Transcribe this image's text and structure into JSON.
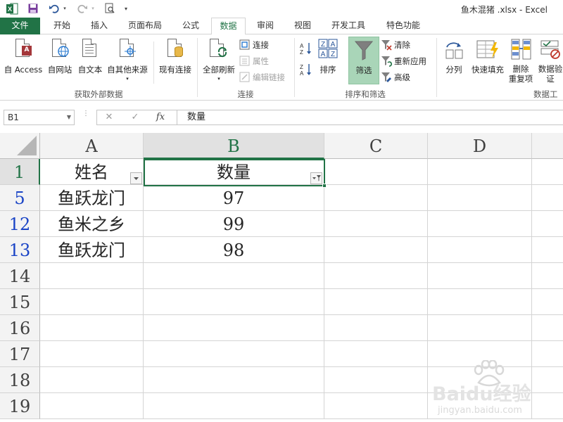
{
  "window": {
    "title": "鱼木混猪 .xlsx - Excel"
  },
  "tabs": [
    {
      "label": "文件"
    },
    {
      "label": "开始"
    },
    {
      "label": "插入"
    },
    {
      "label": "页面布局"
    },
    {
      "label": "公式"
    },
    {
      "label": "数据"
    },
    {
      "label": "审阅"
    },
    {
      "label": "视图"
    },
    {
      "label": "开发工具"
    },
    {
      "label": "特色功能"
    }
  ],
  "active_tab": "数据",
  "ribbon": {
    "get_external": {
      "buttons": [
        "自 Access",
        "自网站",
        "自文本",
        "自其他来源",
        "现有连接"
      ],
      "group_label": "获取外部数据"
    },
    "connections": {
      "refresh_all": "全部刷新",
      "connections": "连接",
      "properties": "属性",
      "edit_links": "编辑链接",
      "group_label": "连接"
    },
    "sort_filter": {
      "sort": "排序",
      "filter": "筛选",
      "clear": "清除",
      "reapply": "重新应用",
      "advanced": "高级",
      "group_label": "排序和筛选"
    },
    "data_tools": {
      "text_to_columns": "分列",
      "flash_fill": "快速填充",
      "remove_duplicates_line1": "删除",
      "remove_duplicates_line2": "重复项",
      "validation_line1": "数据验",
      "validation_line2": "证",
      "group_label": "数据工"
    }
  },
  "formula_bar": {
    "name_box": "B1",
    "cancel": "✕",
    "enter": "✓",
    "fx": "fx",
    "content": "数量"
  },
  "sheet": {
    "columns": [
      "A",
      "B",
      "C",
      "D"
    ],
    "selected_column": "B",
    "rows": [
      {
        "row_num": "1",
        "cells": [
          "姓名",
          "数量",
          "",
          ""
        ],
        "header": true
      },
      {
        "row_num": "5",
        "cells": [
          "鱼跃龙门",
          "97",
          "",
          ""
        ],
        "filtered": true
      },
      {
        "row_num": "12",
        "cells": [
          "鱼米之乡",
          "99",
          "",
          ""
        ],
        "filtered": true
      },
      {
        "row_num": "13",
        "cells": [
          "鱼跃龙门",
          "98",
          "",
          ""
        ],
        "filtered": true
      },
      {
        "row_num": "14",
        "cells": [
          "",
          "",
          "",
          ""
        ]
      },
      {
        "row_num": "15",
        "cells": [
          "",
          "",
          "",
          ""
        ]
      },
      {
        "row_num": "16",
        "cells": [
          "",
          "",
          "",
          ""
        ]
      },
      {
        "row_num": "17",
        "cells": [
          "",
          "",
          "",
          ""
        ]
      },
      {
        "row_num": "18",
        "cells": [
          "",
          "",
          "",
          ""
        ]
      },
      {
        "row_num": "19",
        "cells": [
          "",
          "",
          "",
          ""
        ]
      }
    ]
  },
  "watermark": {
    "brand": "Baidu经验",
    "url": "jingyan.baidu.com"
  },
  "colors": {
    "excel_green": "#217346",
    "filtered_row_blue": "#1a44c6",
    "filter_active_bg": "#a9d5b8"
  }
}
